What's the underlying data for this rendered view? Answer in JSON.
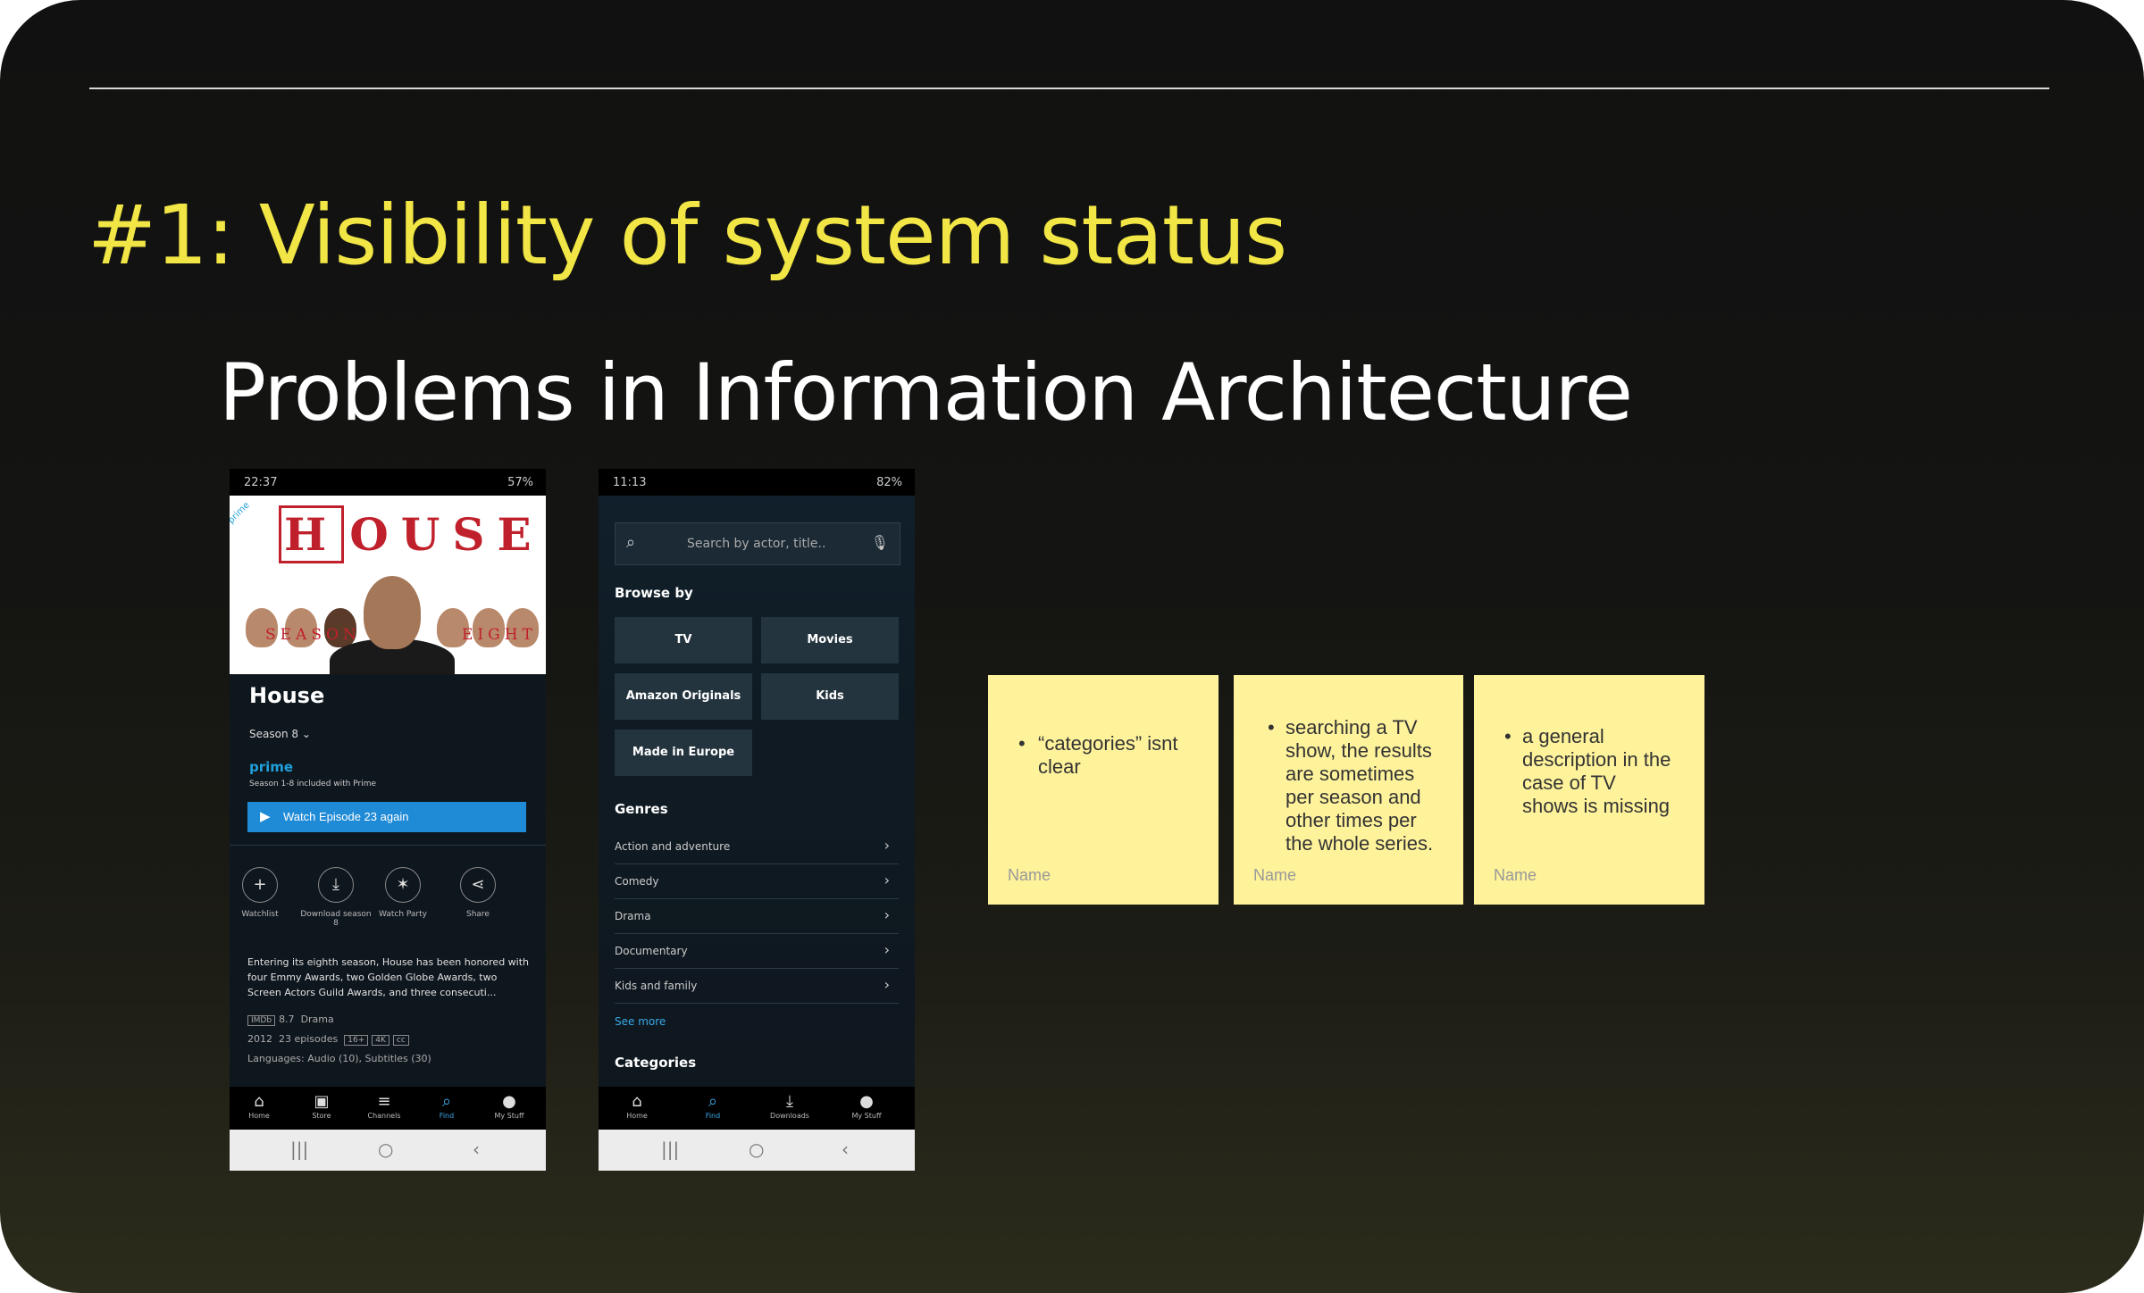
{
  "slide": {
    "title": "#1: Visibility of system status",
    "subtitle": "Problems in Information Architecture"
  },
  "phone1": {
    "status_time": "22:37",
    "status_right": "57%",
    "prime_tag": "prime",
    "logo_text": "OUSE",
    "logo_boxed": "H",
    "season_label": "SEASON",
    "eight_label": "EIGHT",
    "show_title": "House",
    "season_select": "Season 8",
    "prime_word": "prime",
    "included": "Season 1-8 included with Prime",
    "watch_button": "Watch Episode 23 again",
    "actions": [
      {
        "label": "Watchlist",
        "icon": "plus-icon"
      },
      {
        "label": "Download season 8",
        "icon": "download-icon"
      },
      {
        "label": "Watch Party",
        "icon": "party-icon"
      },
      {
        "label": "Share",
        "icon": "share-icon"
      }
    ],
    "description": "Entering its eighth season, House has been honored with four Emmy Awards, two Golden Globe Awards, two Screen Actors Guild Awards, and three consecuti...",
    "rating": "8.7",
    "genre": "Drama",
    "year": "2012",
    "episodes": "23 episodes",
    "age": "16+",
    "languages": "Languages: Audio (10), Subtitles (30)",
    "nav": [
      "Home",
      "Store",
      "Channels",
      "Find",
      "My Stuff"
    ],
    "nav_active": "Find"
  },
  "phone2": {
    "status_time": "11:13",
    "status_right": "82%",
    "search_placeholder": "Search by actor, title..",
    "browse_by": "Browse by",
    "tiles": [
      "TV",
      "Movies",
      "Amazon Originals",
      "Kids",
      "Made in Europe"
    ],
    "genres_title": "Genres",
    "genres": [
      "Action and adventure",
      "Comedy",
      "Drama",
      "Documentary",
      "Kids and family"
    ],
    "see_more": "See more",
    "categories_title": "Categories",
    "nav": [
      "Home",
      "Find",
      "Downloads",
      "My Stuff"
    ],
    "nav_active": "Find"
  },
  "notes": [
    {
      "text_lines": [
        "“categories” isnt",
        "clear"
      ],
      "name": "Name"
    },
    {
      "text_lines": [
        "searching a TV",
        "show, the results",
        "are sometimes",
        "per season and",
        "other times per",
        "the whole series."
      ],
      "name": "Name"
    },
    {
      "text_lines": [
        "a general",
        "description in the",
        "case of TV",
        "shows is missing"
      ],
      "name": "Name"
    }
  ],
  "colors": {
    "title": "#f1e645",
    "note": "#fef29b",
    "prime_blue": "#1fa0db"
  }
}
